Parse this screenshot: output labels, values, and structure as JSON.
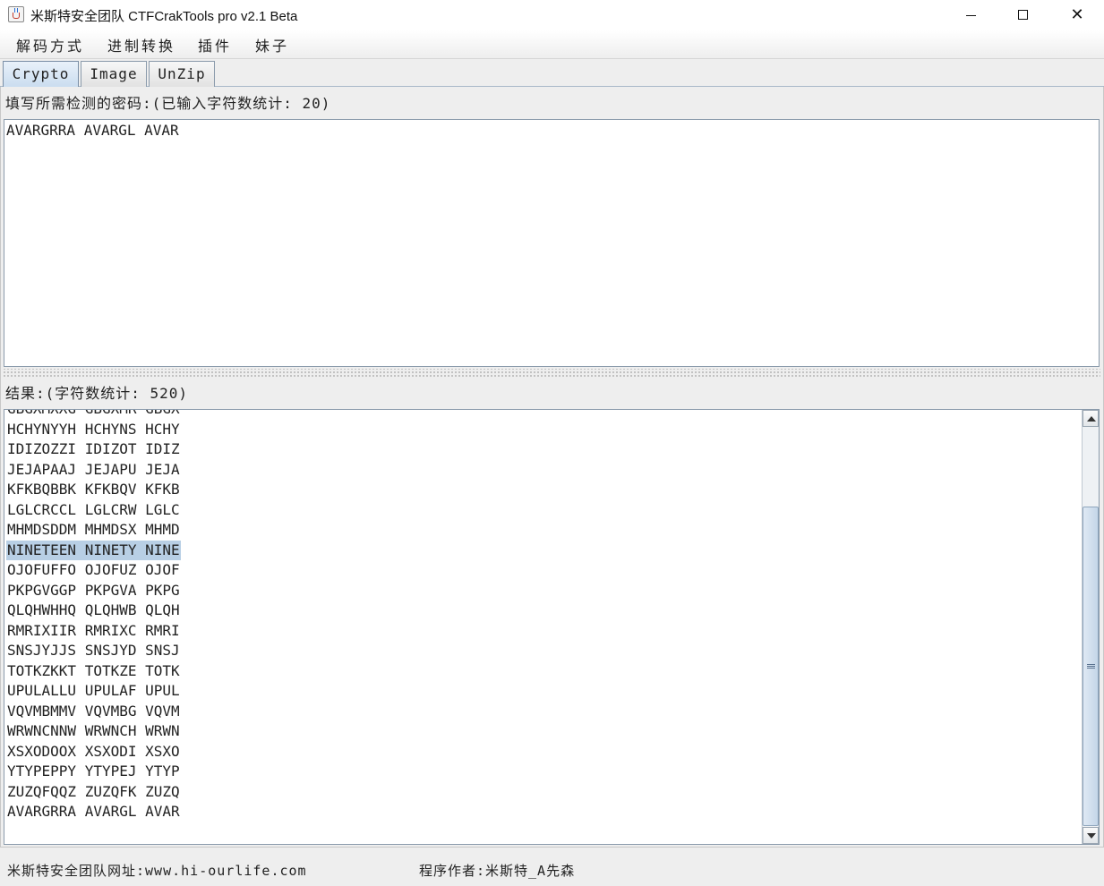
{
  "window": {
    "title": "米斯特安全团队 CTFCrakTools pro v2.1 Beta",
    "minimize": "—",
    "maximize": "☐",
    "close": "✕"
  },
  "menu": [
    "解码方式",
    "进制转换",
    "插件",
    "妹子"
  ],
  "tabs": [
    {
      "label": "Crypto",
      "active": true
    },
    {
      "label": "Image",
      "active": false
    },
    {
      "label": "UnZip",
      "active": false
    }
  ],
  "input": {
    "label": "填写所需检测的密码:(已输入字符数统计: 20)",
    "value": "AVARGRRA AVARGL AVAR"
  },
  "output": {
    "label": "结果:(字符数统计: 520)",
    "lines": [
      "GBGXMXXG GBGXMR GBGX",
      "HCHYNYYH HCHYNS HCHY",
      "IDIZOZZI IDIZOT IDIZ",
      "JEJAPAAJ JEJAPU JEJA",
      "KFKBQBBK KFKBQV KFKB",
      "LGLCRCCL LGLCRW LGLC",
      "MHMDSDDM MHMDSX MHMD",
      "NINETEEN NINETY NINE",
      "OJOFUFFO OJOFUZ OJOF",
      "PKPGVGGP PKPGVA PKPG",
      "QLQHWHHQ QLQHWB QLQH",
      "RMRIXIIR RMRIXC RMRI",
      "SNSJYJJS SNSJYD SNSJ",
      "TOTKZKKT TOTKZE TOTK",
      "UPULALLU UPULAF UPUL",
      "VQVMBMMV VQVMBG VQVM",
      "WRWNCNNW WRWNCH WRWN",
      "XSXODOOX XSXODI XSXO",
      "YTYPEPPY YTYPEJ YTYP",
      "ZUZQFQQZ ZUZQFK ZUZQ",
      "AVARGRRA AVARGL AVAR"
    ],
    "selected_index": 7
  },
  "status": {
    "website": "米斯特安全团队网址:www.hi-ourlife.com",
    "author": "程序作者:米斯特_A先森"
  }
}
